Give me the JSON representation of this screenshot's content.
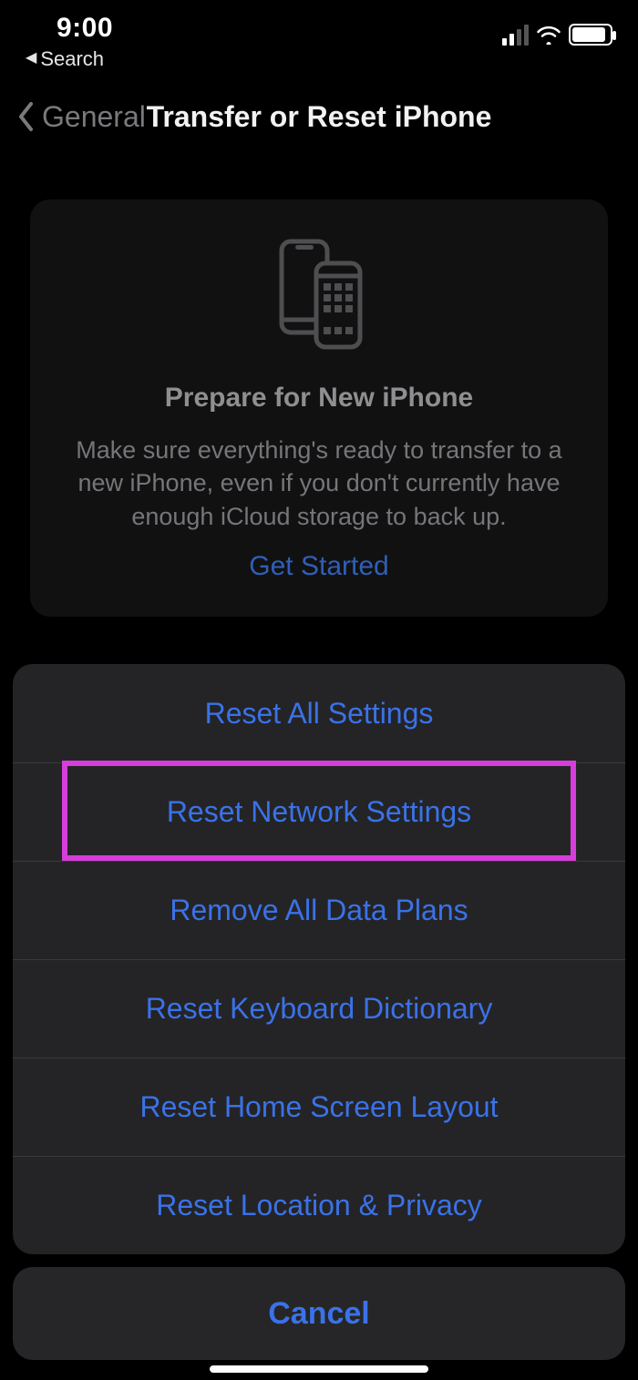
{
  "status": {
    "time": "9:00",
    "back_app": "Search"
  },
  "nav": {
    "back_label": "General",
    "title": "Transfer or Reset iPhone"
  },
  "prepare_card": {
    "title": "Prepare for New iPhone",
    "description": "Make sure everything's ready to transfer to a new iPhone, even if you don't currently have enough iCloud storage to back up.",
    "cta": "Get Started"
  },
  "action_sheet": {
    "options": [
      "Reset All Settings",
      "Reset Network Settings",
      "Remove All Data Plans",
      "Reset Keyboard Dictionary",
      "Reset Home Screen Layout",
      "Reset Location & Privacy"
    ],
    "cancel": "Cancel",
    "highlighted_index": 1
  }
}
